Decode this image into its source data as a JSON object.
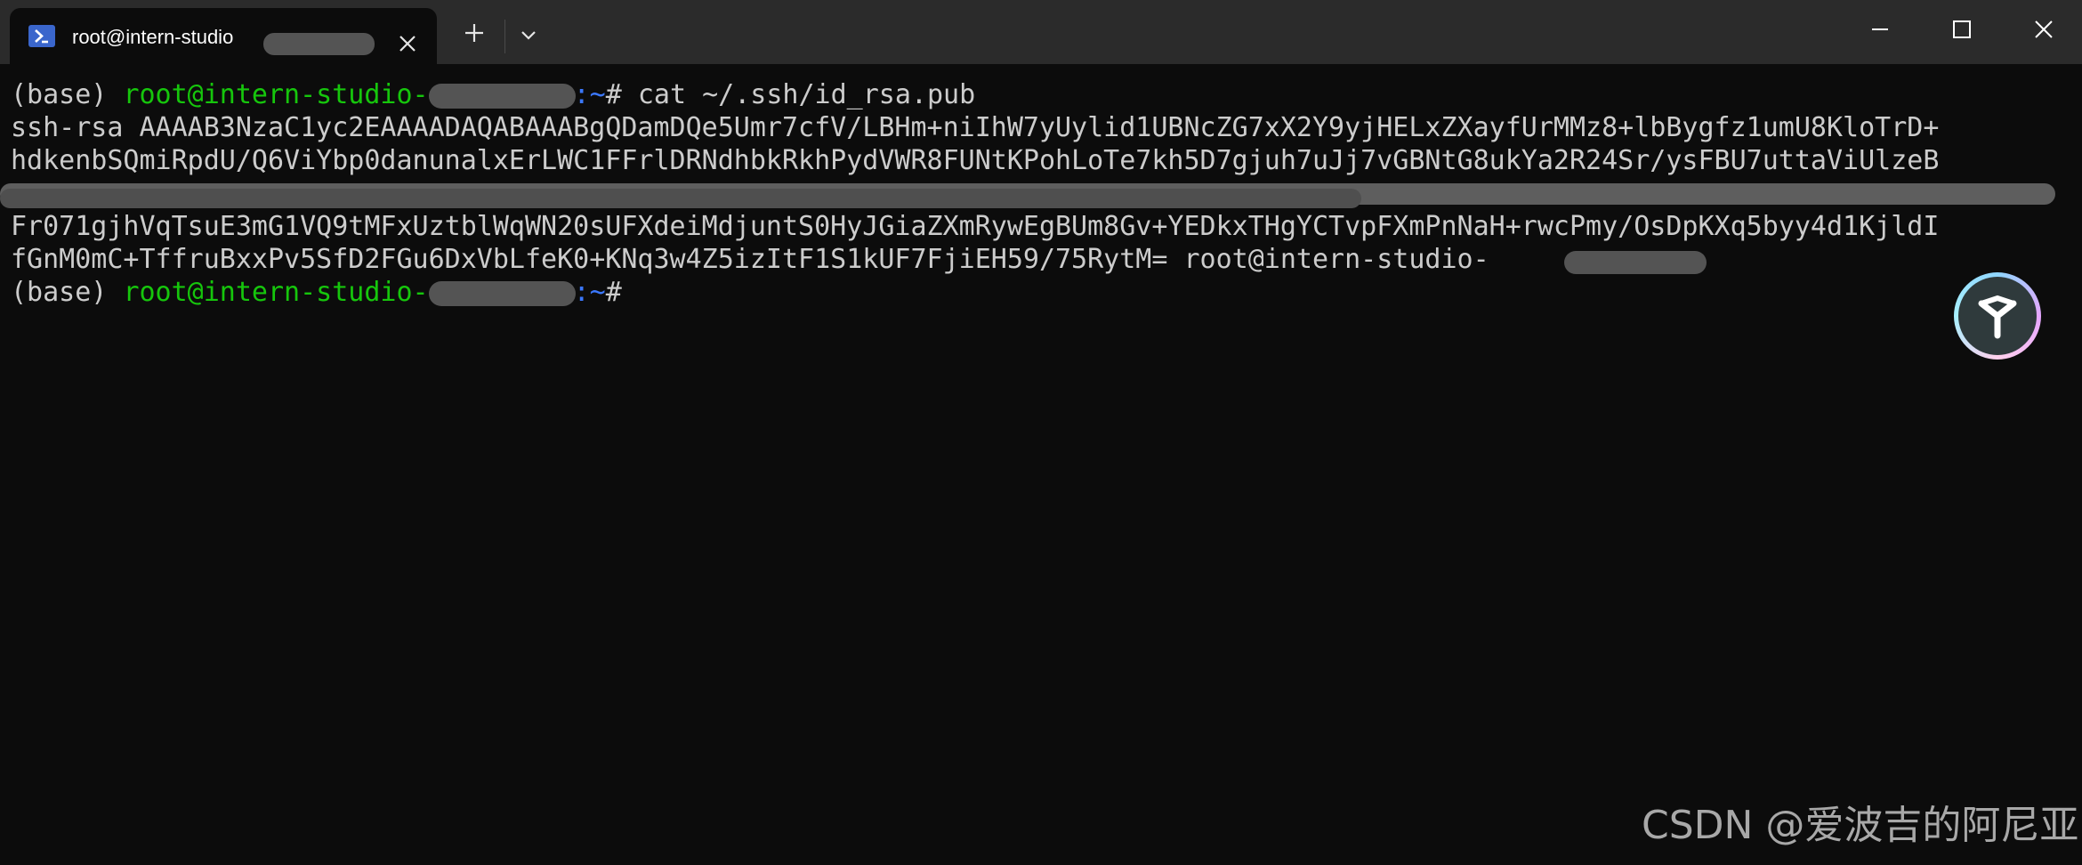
{
  "tab": {
    "title": "root@intern-studio",
    "icon": "powershell-icon",
    "accent": "#3a66cc"
  },
  "window_controls": {
    "minimize_icon": "minimize-icon",
    "maximize_icon": "maximize-icon",
    "close_icon": "close-icon"
  },
  "terminal": {
    "prompt_env": "(base) ",
    "prompt_user_host": "root@intern-studio-",
    "prompt_path": ":~",
    "prompt_symbol": "# ",
    "command": "cat ~/.ssh/id_rsa.pub",
    "key_lines": [
      "ssh-rsa AAAAB3NzaC1yc2EAAAADAQABAAABgQDamDQe5Umr7cfV/LBHm+niIhW7yUylid1UBNcZG7xX2Y9yjHELxZXayfUrMMz8+lbBygfz1umU8KloTrD+",
      "hdkenbSQmiRpdU/Q6ViYbp0danunalxErLWC1FFrlDRNdhbkRkhPydVWR8FUNtKPohLoTe7kh5D7gjuh7uJj7vGBNtG8ukYa2R24Sr/ysFBU7uttaViUlzeB",
      "Fr071gjhVqTsuE3mG1VQ9tMFxUztblWqWN20sUFXdeiMdjuntS0HyJGiaZXmRywEgBUm8Gv+YEDkxTHgYCTvpFXmPnNaH+rwcPmy/OsDpKXq5byy4d1KjldI",
      "fGnM0mC+TffruBxxPv5SfD2FGu6DxVbLfeK0+KNq3w4Z5izItF1S1kUF7FjiEH59/75RytM= root@intern-studio-"
    ],
    "colors": {
      "user_host": "#16c60c",
      "path": "#3b78ff",
      "text": "#cccccc"
    }
  },
  "watermark": "CSDN @爱波吉的阿尼亚"
}
